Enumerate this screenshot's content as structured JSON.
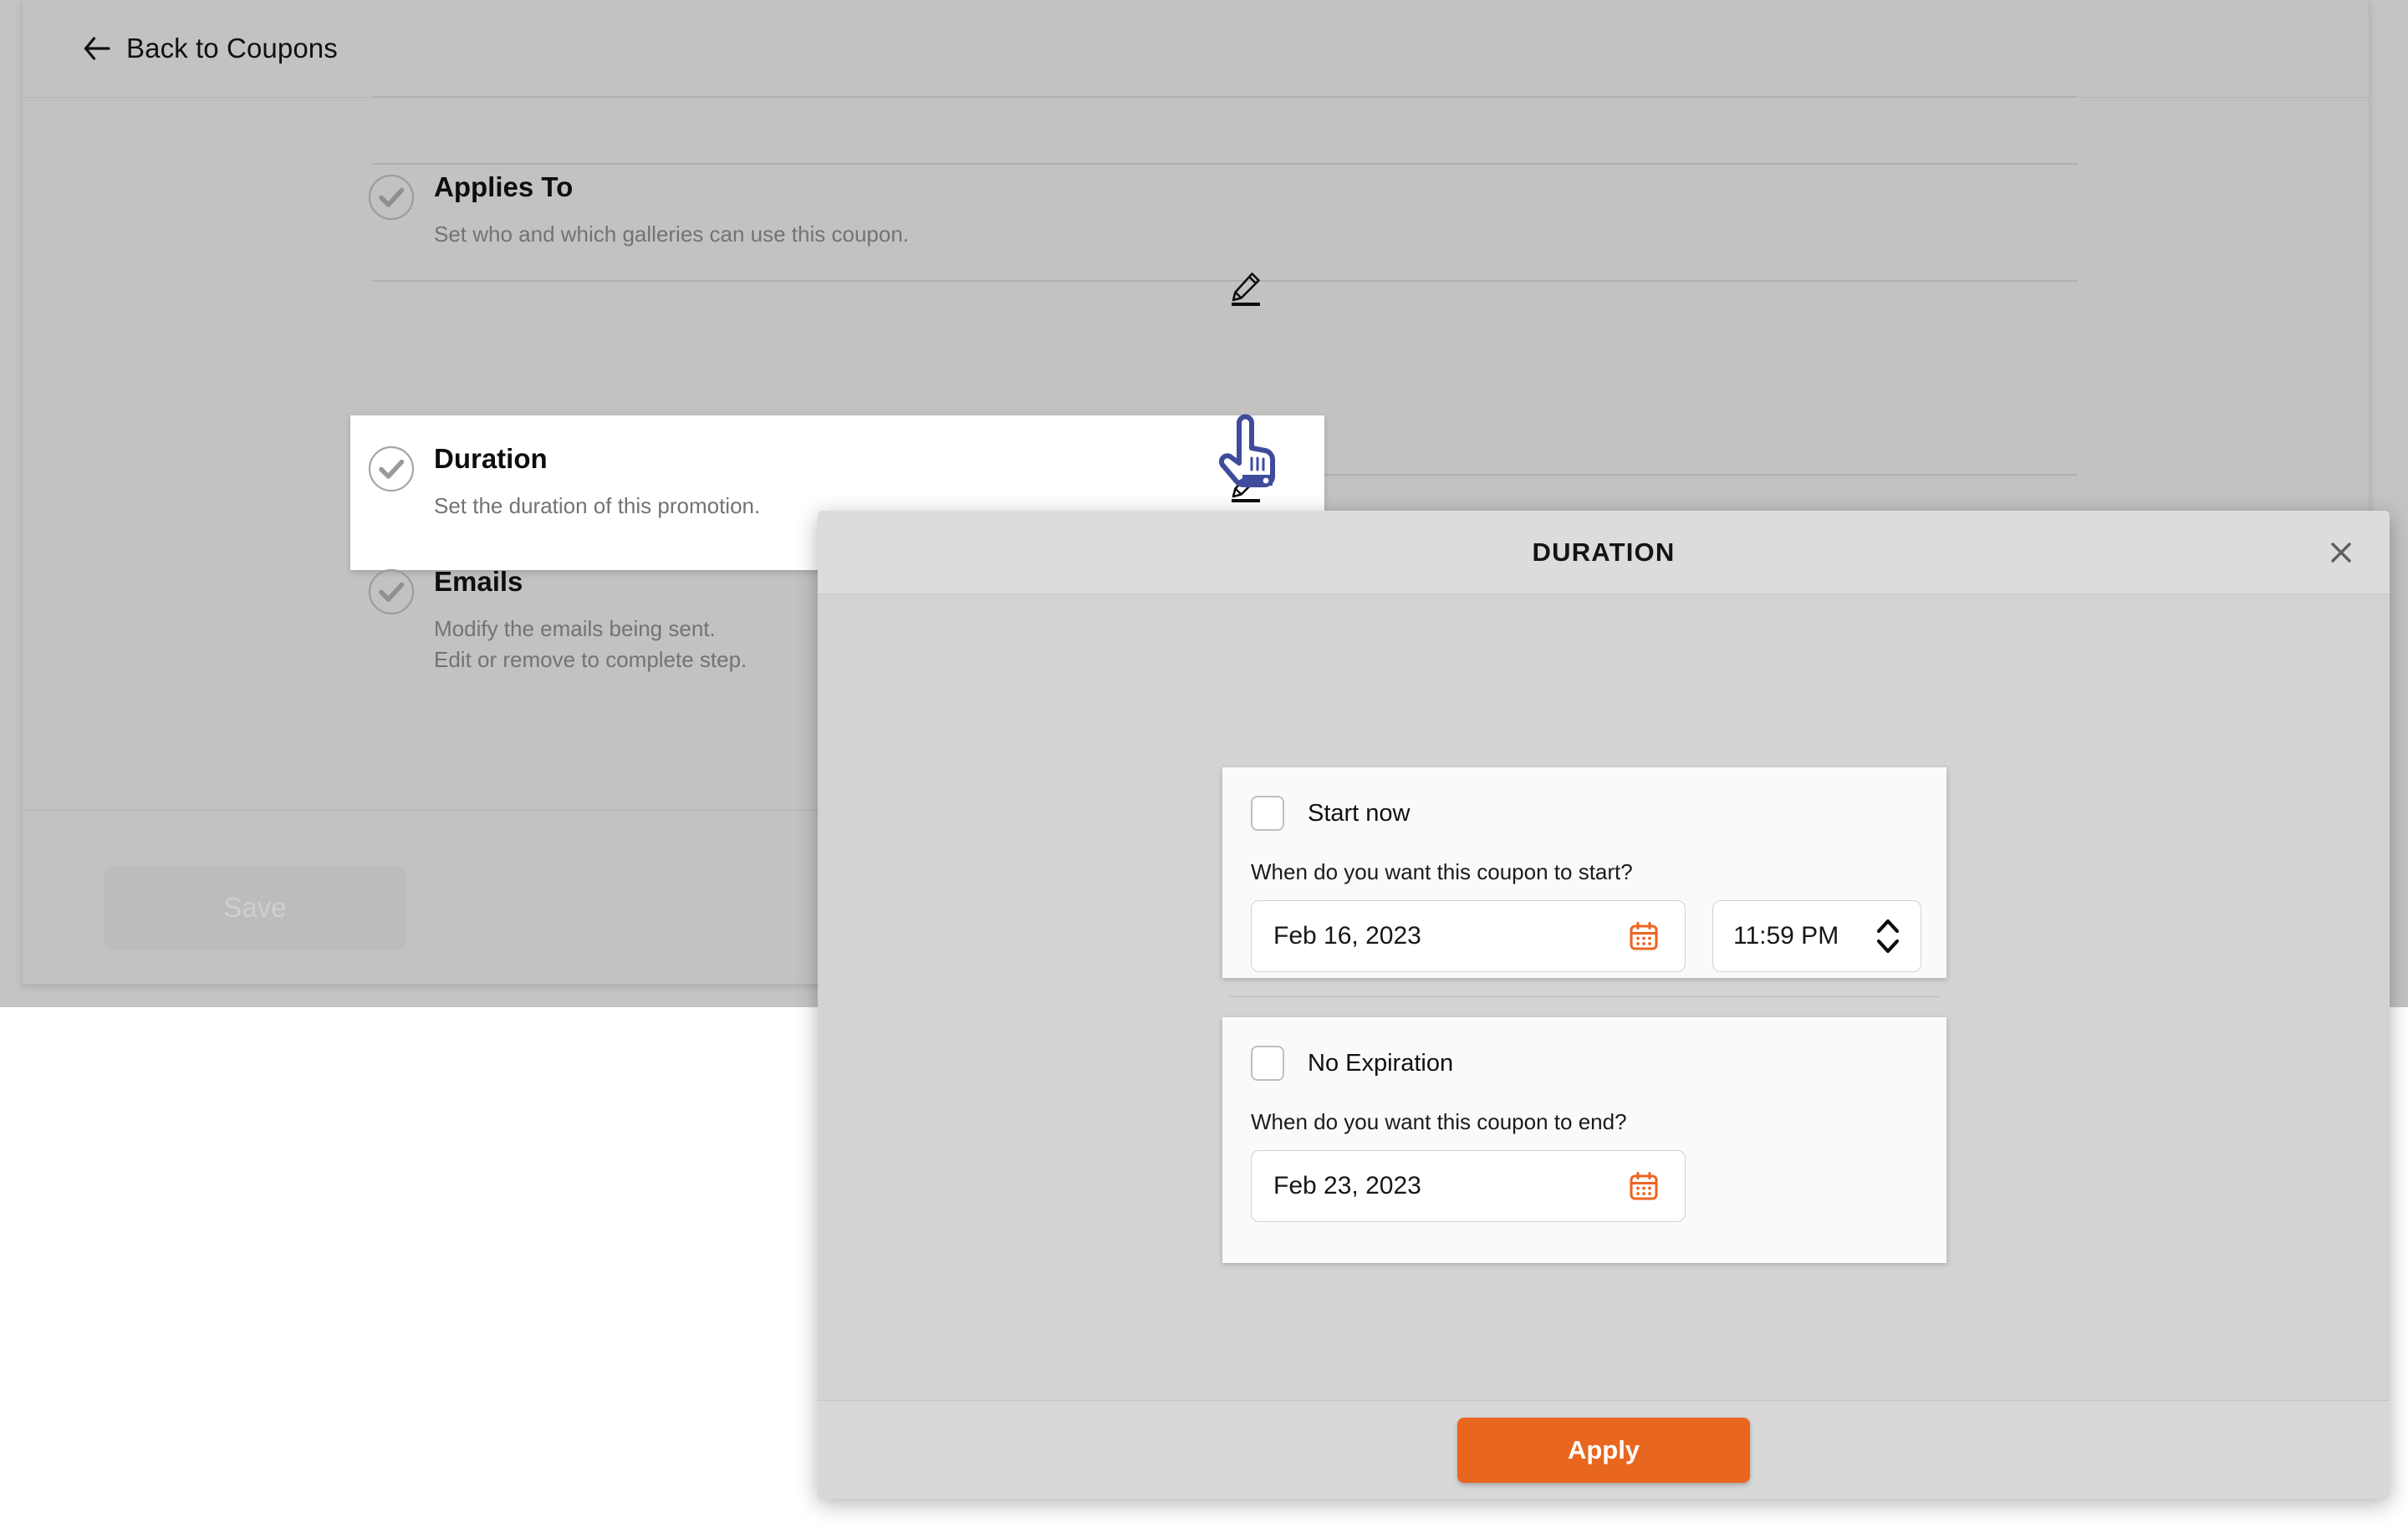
{
  "app": {
    "back_link_label": "Back to Coupons",
    "save_label": "Save"
  },
  "steps": [
    {
      "title": "Applies To",
      "description": "Set who and which galleries can use this coupon.",
      "status_icon": "check-circle-icon",
      "edit_icon": "pencil-edit-icon"
    },
    {
      "title": "Duration",
      "description": "Set the duration of this promotion.",
      "status_icon": "check-circle-icon",
      "edit_icon": "pencil-edit-icon"
    },
    {
      "title": "Emails",
      "description": "Modify the emails being sent. Edit or remove to complete step.",
      "status_icon": "check-circle-icon"
    }
  ],
  "modal": {
    "title": "DURATION",
    "close_icon": "close-icon",
    "start_section": {
      "checkbox_label": "Start now",
      "checkbox_checked": false,
      "question": "When do you want this coupon to start?",
      "date_value": "Feb 16, 2023",
      "date_icon": "calendar-icon",
      "time_value": "11:59 PM",
      "time_spinner_icon": "chevron-up-down-icon"
    },
    "end_section": {
      "checkbox_label": "No Expiration",
      "checkbox_checked": false,
      "question": "When do you want this coupon to end?",
      "date_value": "Feb 23, 2023",
      "date_icon": "calendar-icon"
    },
    "apply_label": "Apply"
  },
  "colors": {
    "accent_orange": "#e9661e",
    "cursor_blue": "#3f4c9c",
    "page_gray": "#c4c4c4",
    "modal_gray": "#d3d3d3"
  },
  "cursor": {
    "icon": "pointing-hand-cursor"
  }
}
